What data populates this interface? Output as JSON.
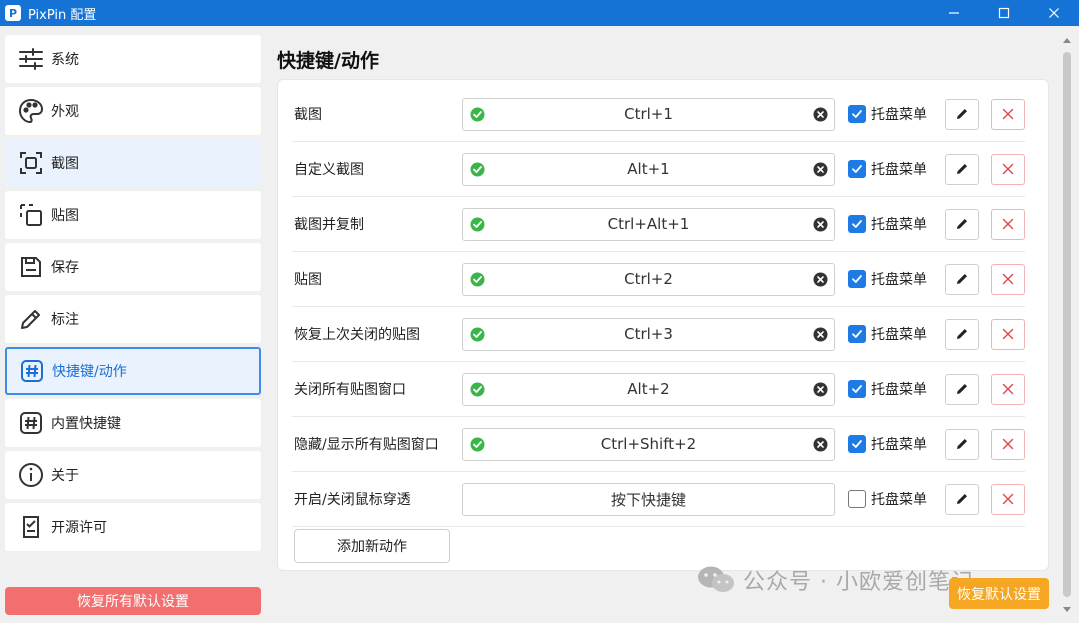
{
  "window": {
    "title": "PixPin 配置",
    "logo_letter": "P"
  },
  "sidebar": {
    "items": [
      {
        "label": "系统",
        "icon": "sliders-icon"
      },
      {
        "label": "外观",
        "icon": "palette-icon"
      },
      {
        "label": "截图",
        "icon": "screenshot-icon"
      },
      {
        "label": "贴图",
        "icon": "pin-image-icon"
      },
      {
        "label": "保存",
        "icon": "save-icon"
      },
      {
        "label": "标注",
        "icon": "pencil-icon"
      },
      {
        "label": "快捷键/动作",
        "icon": "hash-icon"
      },
      {
        "label": "内置快捷键",
        "icon": "hash-icon"
      },
      {
        "label": "关于",
        "icon": "info-icon"
      },
      {
        "label": "开源许可",
        "icon": "license-icon"
      }
    ],
    "active_index": 6,
    "hover_index": 2,
    "restore_all_label": "恢复所有默认设置"
  },
  "main": {
    "title": "快捷键/动作",
    "rows": [
      {
        "label": "截图",
        "hotkey": "Ctrl+1",
        "set": true,
        "tray_label": "托盘菜单",
        "tray_checked": true
      },
      {
        "label": "自定义截图",
        "hotkey": "Alt+1",
        "set": true,
        "tray_label": "托盘菜单",
        "tray_checked": true
      },
      {
        "label": "截图并复制",
        "hotkey": "Ctrl+Alt+1",
        "set": true,
        "tray_label": "托盘菜单",
        "tray_checked": true
      },
      {
        "label": "贴图",
        "hotkey": "Ctrl+2",
        "set": true,
        "tray_label": "托盘菜单",
        "tray_checked": true
      },
      {
        "label": "恢复上次关闭的贴图",
        "hotkey": "Ctrl+3",
        "set": true,
        "tray_label": "托盘菜单",
        "tray_checked": true
      },
      {
        "label": "关闭所有贴图窗口",
        "hotkey": "Alt+2",
        "set": true,
        "tray_label": "托盘菜单",
        "tray_checked": true
      },
      {
        "label": "隐藏/显示所有贴图窗口",
        "hotkey": "Ctrl+Shift+2",
        "set": true,
        "tray_label": "托盘菜单",
        "tray_checked": true
      },
      {
        "label": "开启/关闭鼠标穿透",
        "hotkey": "按下快捷键",
        "set": false,
        "tray_label": "托盘菜单",
        "tray_checked": false
      }
    ],
    "add_label": "添加新动作",
    "restore_label": "恢复默认设置"
  },
  "watermark": {
    "text": "公众号 · 小欧爱创笔记"
  },
  "colors": {
    "titlebar": "#1573d6",
    "accent": "#1e7be6",
    "danger": "#f36f6f",
    "warning": "#f5a623",
    "success": "#3bb54a"
  }
}
